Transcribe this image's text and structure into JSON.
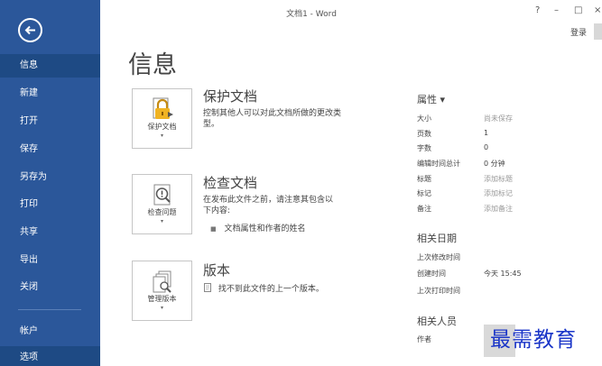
{
  "titlebar": {
    "title": "文档1 - Word",
    "help": "?",
    "minimize": "–",
    "restore": "□",
    "close": "×",
    "login": "登录"
  },
  "sidebar": {
    "items": [
      "信息",
      "新建",
      "打开",
      "保存",
      "另存为",
      "打印",
      "共享",
      "导出",
      "关闭",
      "帐户",
      "选项"
    ]
  },
  "page": {
    "title": "信息"
  },
  "sections": {
    "protect": {
      "tile_label": "保护文档",
      "caret": "▾",
      "heading": "保护文档",
      "line1": "控制其他人可以对此文档所做的更改类",
      "line2": "型。"
    },
    "inspect": {
      "tile_label": "检查问题",
      "caret": "▾",
      "heading": "检查文档",
      "line1": "在发布此文件之前，请注意其包含以",
      "line2": "下内容:",
      "bullet": "文档属性和作者的姓名"
    },
    "versions": {
      "tile_label": "管理版本",
      "caret": "▾",
      "heading": "版本",
      "line1": "找不到此文件的上一个版本。"
    }
  },
  "properties": {
    "heading": "属性 ▾",
    "rows": [
      {
        "label": "大小",
        "value": "尚未保存"
      },
      {
        "label": "页数",
        "value": "1"
      },
      {
        "label": "字数",
        "value": "0"
      },
      {
        "label": "编辑时间总计",
        "value": "0 分钟"
      },
      {
        "label": "标题",
        "value": "添加标题"
      },
      {
        "label": "标记",
        "value": "添加标记"
      },
      {
        "label": "备注",
        "value": "添加备注"
      }
    ],
    "dates_heading": "相关日期",
    "dates": [
      {
        "label": "上次修改时间",
        "value": ""
      },
      {
        "label": "创建时间",
        "value": "今天 15:45"
      },
      {
        "label": "上次打印时间",
        "value": ""
      }
    ],
    "people_heading": "相关人员",
    "author_label": "作者"
  },
  "watermark": "最需教育",
  "colors": {
    "sidebar": "#2b579a",
    "sidebar_active": "#1e4a84",
    "lock": "#f0b323"
  }
}
